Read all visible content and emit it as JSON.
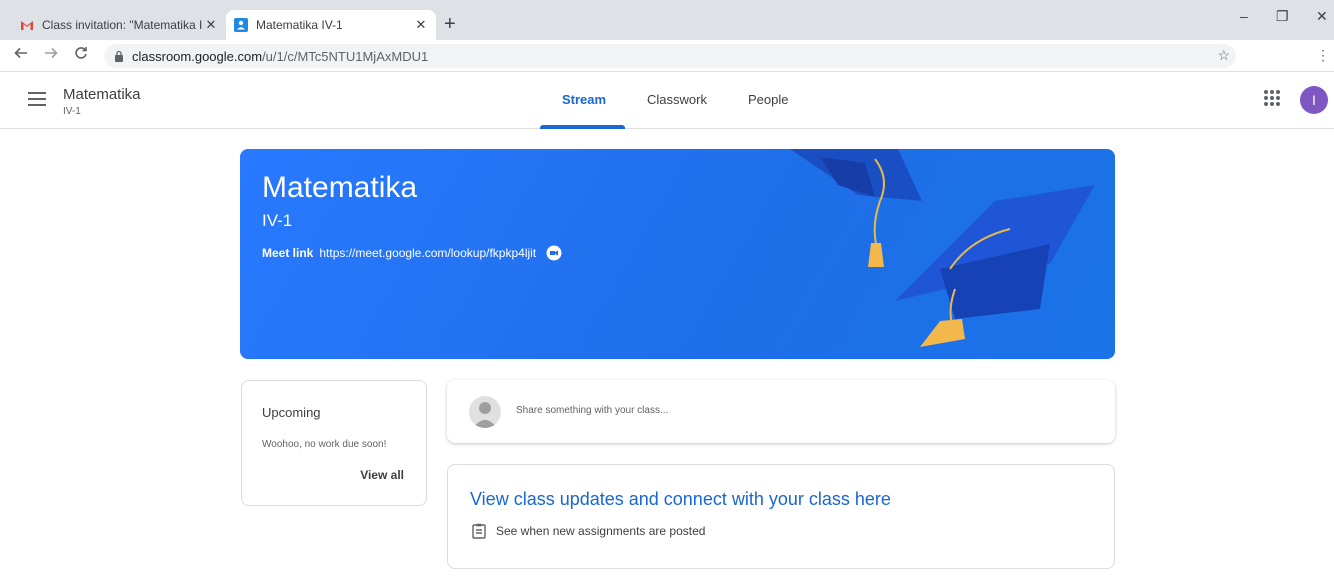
{
  "browser": {
    "tabs": [
      {
        "title": "Class invitation: \"Matematika IV-",
        "close": "✕"
      },
      {
        "title": "Matematika IV-1",
        "close": "✕"
      }
    ],
    "new_tab": "+",
    "url_host": "classroom.google.com",
    "url_path": "/u/1/c/MTc5NTU1MjAxMDU1",
    "window_controls": {
      "minimize": "–",
      "maximize": "❐",
      "close": "✕"
    }
  },
  "header": {
    "class_name": "Matematika",
    "class_section": "IV-1",
    "tabs": [
      {
        "label": "Stream",
        "active": true
      },
      {
        "label": "Classwork",
        "active": false
      },
      {
        "label": "People",
        "active": false
      }
    ],
    "avatar_letter": "I"
  },
  "banner": {
    "title": "Matematika",
    "section": "IV-1",
    "meet_label": "Meet link",
    "meet_url": "https://meet.google.com/lookup/fkpkp4ljit"
  },
  "upcoming": {
    "title": "Upcoming",
    "message": "Woohoo, no work due soon!",
    "view_all": "View all"
  },
  "share": {
    "placeholder": "Share something with your class..."
  },
  "updates": {
    "title": "View class updates and connect with your class here",
    "item": "See when new assignments are posted"
  },
  "colors": {
    "accent": "#1967d2",
    "banner": "#1e6ee8",
    "avatar": "#7e57c2"
  }
}
